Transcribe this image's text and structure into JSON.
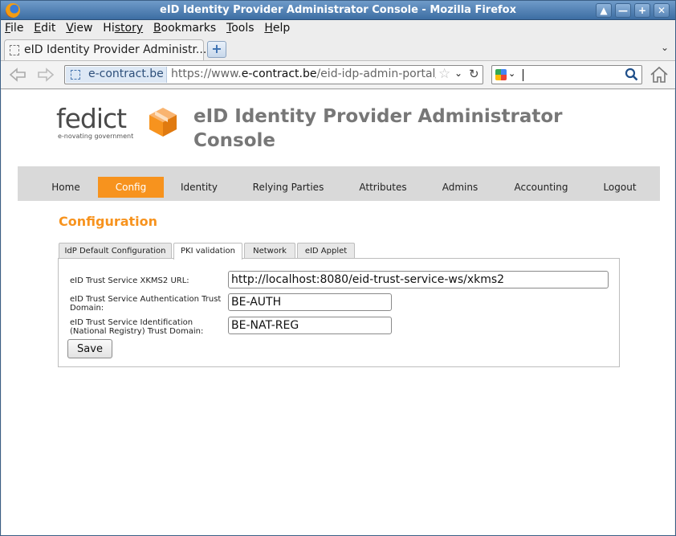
{
  "window": {
    "title": "eID Identity Provider Administrator Console - Mozilla Firefox",
    "buttons": {
      "scroll_up": "▲",
      "minimize": "—",
      "maximize": "+",
      "close": "✕"
    }
  },
  "menubar": {
    "items": [
      {
        "first": "F",
        "rest": "ile"
      },
      {
        "first": "E",
        "rest": "dit"
      },
      {
        "first": "V",
        "rest": "iew"
      },
      {
        "first": "Hi",
        "rest": "story"
      },
      {
        "first": "B",
        "rest": "ookmarks"
      },
      {
        "first": "T",
        "rest": "ools"
      },
      {
        "first": "H",
        "rest": "elp"
      }
    ]
  },
  "tabstrip": {
    "active_tab_title": "eID Identity Provider Administr...",
    "new_tab": "+",
    "tab_list": "⌄"
  },
  "navbar": {
    "site_identity": "e-contract.be",
    "url_prefix": "https://www.",
    "url_domain": "e-contract.be",
    "url_path": "/eid-idp-admin-portal/",
    "search_value": ""
  },
  "page": {
    "logo_word": "fedict",
    "logo_tagline": "e-novating government",
    "title": "eID Identity Provider Administrator Console",
    "nav": [
      "Home",
      "Config",
      "Identity",
      "Relying Parties",
      "Attributes",
      "Admins",
      "Accounting",
      "Logout"
    ],
    "nav_active": "Config",
    "section_title": "Configuration",
    "tabs": [
      "IdP Default Configuration",
      "PKI validation",
      "Network",
      "eID Applet"
    ],
    "tab_active": "PKI validation",
    "form": {
      "xkms_label": "eID Trust Service XKMS2 URL:",
      "xkms_value": "http://localhost:8080/eid-trust-service-ws/xkms2",
      "auth_label": "eID Trust Service Authentication Trust Domain:",
      "auth_value": "BE-AUTH",
      "ident_label": "eID Trust Service Identification (National Registry) Trust Domain:",
      "ident_value": "BE-NAT-REG",
      "save_label": "Save"
    }
  },
  "colors": {
    "accent": "#f7931e",
    "nav_bg": "#d9d9d9",
    "title_grey": "#777777"
  }
}
